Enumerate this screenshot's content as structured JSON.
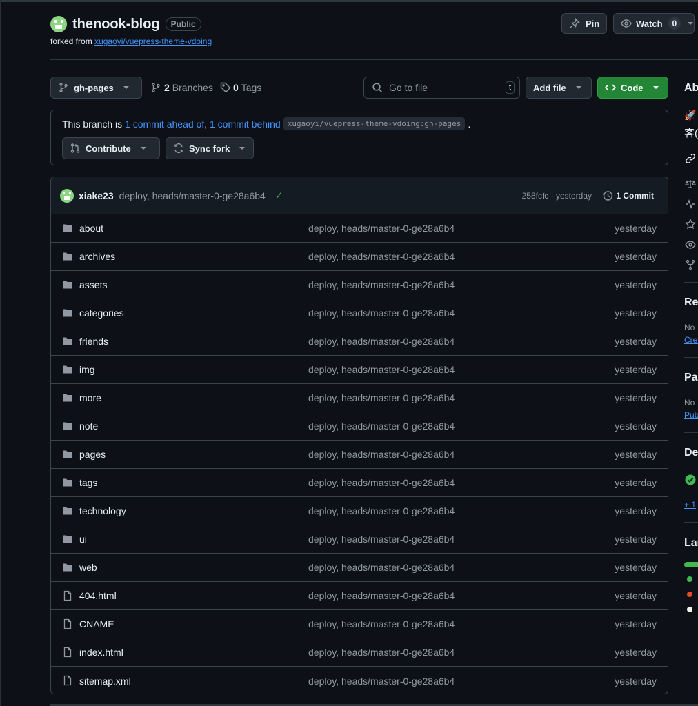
{
  "repo": {
    "name": "thenook-blog",
    "visibility": "Public",
    "forked_prefix": "forked from",
    "forked_from": "xugaoyi/vuepress-theme-vdoing"
  },
  "actions": {
    "pin": "Pin",
    "watch": "Watch",
    "watch_count": "0"
  },
  "toolbar": {
    "branch": "gh-pages",
    "branches_count": "2",
    "branches_label": "Branches",
    "tags_count": "0",
    "tags_label": "Tags",
    "search_placeholder": "Go to file",
    "search_kbd": "t",
    "add_file": "Add file",
    "code": "Code"
  },
  "ahead": {
    "prefix": "This branch is",
    "ahead_link": "1 commit ahead of",
    "comma": ",",
    "behind_link": "1 commit behind",
    "upstream": "xugaoyi/vuepress-theme-vdoing:gh-pages",
    "suffix": ".",
    "contribute": "Contribute",
    "sync_fork": "Sync fork"
  },
  "latest_commit": {
    "author": "xiake23",
    "message": "deploy, heads/master-0-ge28a6b4",
    "hash_time": "258fcfc · yesterday",
    "commits": "1 Commit"
  },
  "files": [
    {
      "name": "about",
      "type": "dir",
      "message": "deploy, heads/master-0-ge28a6b4",
      "age": "yesterday"
    },
    {
      "name": "archives",
      "type": "dir",
      "message": "deploy, heads/master-0-ge28a6b4",
      "age": "yesterday"
    },
    {
      "name": "assets",
      "type": "dir",
      "message": "deploy, heads/master-0-ge28a6b4",
      "age": "yesterday"
    },
    {
      "name": "categories",
      "type": "dir",
      "message": "deploy, heads/master-0-ge28a6b4",
      "age": "yesterday"
    },
    {
      "name": "friends",
      "type": "dir",
      "message": "deploy, heads/master-0-ge28a6b4",
      "age": "yesterday"
    },
    {
      "name": "img",
      "type": "dir",
      "message": "deploy, heads/master-0-ge28a6b4",
      "age": "yesterday"
    },
    {
      "name": "more",
      "type": "dir",
      "message": "deploy, heads/master-0-ge28a6b4",
      "age": "yesterday"
    },
    {
      "name": "note",
      "type": "dir",
      "message": "deploy, heads/master-0-ge28a6b4",
      "age": "yesterday"
    },
    {
      "name": "pages",
      "type": "dir",
      "message": "deploy, heads/master-0-ge28a6b4",
      "age": "yesterday"
    },
    {
      "name": "tags",
      "type": "dir",
      "message": "deploy, heads/master-0-ge28a6b4",
      "age": "yesterday"
    },
    {
      "name": "technology",
      "type": "dir",
      "message": "deploy, heads/master-0-ge28a6b4",
      "age": "yesterday"
    },
    {
      "name": "ui",
      "type": "dir",
      "message": "deploy, heads/master-0-ge28a6b4",
      "age": "yesterday"
    },
    {
      "name": "web",
      "type": "dir",
      "message": "deploy, heads/master-0-ge28a6b4",
      "age": "yesterday"
    },
    {
      "name": "404.html",
      "type": "file",
      "message": "deploy, heads/master-0-ge28a6b4",
      "age": "yesterday"
    },
    {
      "name": "CNAME",
      "type": "file",
      "message": "deploy, heads/master-0-ge28a6b4",
      "age": "yesterday"
    },
    {
      "name": "index.html",
      "type": "file",
      "message": "deploy, heads/master-0-ge28a6b4",
      "age": "yesterday"
    },
    {
      "name": "sitemap.xml",
      "type": "file",
      "message": "deploy, heads/master-0-ge28a6b4",
      "age": "yesterday"
    }
  ],
  "sidebar": {
    "about_heading": "Ab",
    "about_desc": "🚀",
    "about_desc2": "客(",
    "releases_heading": "Rel",
    "releases_none": "No",
    "releases_link": "Crea",
    "packages_heading": "Pac",
    "packages_none": "No",
    "packages_link": "Pub",
    "deploy_heading": "De",
    "deploy_more": "+ 1",
    "languages_heading": "Lar",
    "language_colors": [
      "#3fb950",
      "#e34c26",
      "#f1f1f1"
    ]
  },
  "colors": {
    "background": "#0d1117",
    "accent_link": "#4493f8",
    "green_button": "#238636",
    "success": "#3fb950"
  }
}
